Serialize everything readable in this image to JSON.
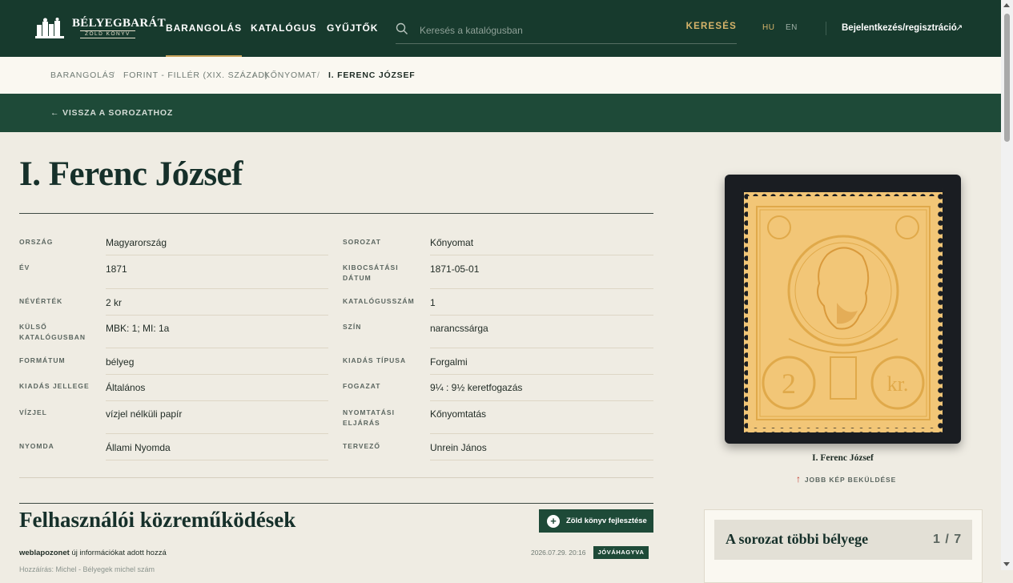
{
  "header": {
    "logo_title": "BÉLYEGBARÁT",
    "logo_subtitle": "ZÖLD KÖNYV",
    "nav": [
      {
        "label": "BARANGOLÁS",
        "active": true
      },
      {
        "label": "KATALÓGUS",
        "active": false
      },
      {
        "label": "GYŰJTŐK",
        "active": false
      }
    ],
    "search_placeholder": "Keresés a katalógusban",
    "search_button": "KERESÉS",
    "languages": [
      {
        "label": "HU",
        "active": true
      },
      {
        "label": "EN",
        "active": false
      }
    ],
    "login_label": "Bejelentkezés/regisztráció",
    "login_icon": "external-arrow-icon"
  },
  "breadcrumb": [
    "BARANGOLÁS",
    "FORINT - FILLÉR (XIX. SZÁZAD)",
    "KŐNYOMAT",
    "I. FERENC JÓZSEF"
  ],
  "back_link": "← VISSZA A SOROZATHOZ",
  "title": "I. Ferenc József",
  "details": {
    "left": [
      {
        "label": "ORSZÁG",
        "value": "Magyarország"
      },
      {
        "label": "ÉV",
        "value": "1871"
      },
      {
        "label": "NÉVÉRTÉK",
        "value": "2 kr"
      },
      {
        "label": "KÜLSŐ KATALÓGUSBAN",
        "value": "MBK: 1; MI: 1a"
      },
      {
        "label": "FORMÁTUM",
        "value": "bélyeg"
      },
      {
        "label": "KIADÁS JELLEGE",
        "value": "Általános"
      },
      {
        "label": "VÍZJEL",
        "value": "vízjel nélküli papír"
      },
      {
        "label": "NYOMDA",
        "value": "Állami Nyomda"
      }
    ],
    "right": [
      {
        "label": "SOROZAT",
        "value": "Kőnyomat"
      },
      {
        "label": "KIBOCSÁTÁSI DÁTUM",
        "value": "1871-05-01"
      },
      {
        "label": "KATALÓGUSSZÁM",
        "value": "1"
      },
      {
        "label": "SZÍN",
        "value": "narancssárga"
      },
      {
        "label": "KIADÁS TÍPUSA",
        "value": "Forgalmi"
      },
      {
        "label": "FOGAZAT",
        "value": "9¼ : 9½ keretfogazás"
      },
      {
        "label": "NYOMTATÁSI ELJÁRÁS",
        "value": "Kőnyomtatás"
      },
      {
        "label": "TERVEZŐ",
        "value": "Unrein János"
      }
    ]
  },
  "contributions": {
    "title": "Felhasználói közreműködések",
    "add_button": "Zöld könyv fejlesztése",
    "items": [
      {
        "user": "weblapozonet",
        "action": "új információkat adott hozzá",
        "date": "2026.07.29. 20:16",
        "status": "JÓVÁHAGYVA"
      }
    ],
    "next_preview": "Hozzáírás: Michel - Bélyegek michel szám"
  },
  "stamp": {
    "caption": "I. Ferenc József",
    "denomination_left": "2",
    "denomination_right": "kr.",
    "submit_label": "JOBB KÉP BEKÜLDÉSE",
    "colors": {
      "stamp": "#f3c46a",
      "frame": "#1a1d22",
      "ink": "#e0a94a"
    }
  },
  "series": {
    "title": "A sorozat többi bélyege",
    "counter": "1 / 7"
  },
  "colors": {
    "header_bg": "#173a2d",
    "accent_gold": "#c9a45c",
    "back_bar": "#1e4a38",
    "page_bg": "#efece3"
  }
}
